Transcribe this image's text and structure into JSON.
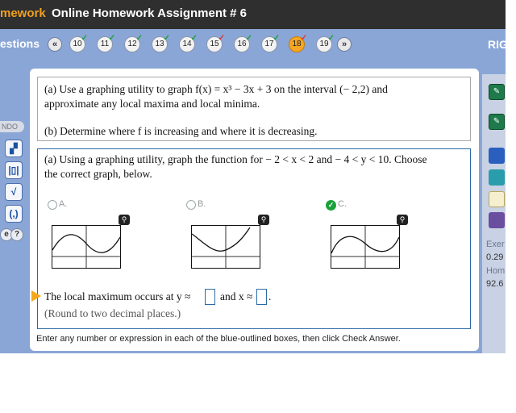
{
  "header": {
    "brand": "mework",
    "assignment_title": "Online Homework Assignment # 6"
  },
  "questions_bar": {
    "label": "estions",
    "prev_icon": "double-chevron-left-icon",
    "next_icon": "double-chevron-right-icon",
    "prev_glyph": "«",
    "next_glyph": "»",
    "items": [
      {
        "number": "10",
        "status": "complete"
      },
      {
        "number": "11",
        "status": "complete"
      },
      {
        "number": "12",
        "status": "complete"
      },
      {
        "number": "13",
        "status": "complete"
      },
      {
        "number": "14",
        "status": "complete"
      },
      {
        "number": "15",
        "status": "partial"
      },
      {
        "number": "16",
        "status": "complete"
      },
      {
        "number": "17",
        "status": "complete"
      },
      {
        "number": "18",
        "status": "current-partial"
      },
      {
        "number": "19",
        "status": "complete"
      }
    ],
    "right_label": "RIG"
  },
  "left_tools": {
    "pill_label": "NDO",
    "help_label": "?",
    "edge_label": "e"
  },
  "question": {
    "part_a_line1": "(a)  Use a graphing utility to graph f(x) = x³ − 3x + 3 on the interval (− 2,2) and",
    "part_a_line2": "approximate any local maxima and local minima.",
    "part_b": "(b)  Determine where f is increasing and where it is decreasing."
  },
  "answer": {
    "prompt_line1": "(a)  Using a graphing utility, graph the function for  − 2 < x < 2 and  − 4 < y < 10.  Choose",
    "prompt_line2": "the correct graph, below.",
    "options": [
      {
        "letter": "A.",
        "selected": false
      },
      {
        "letter": "B.",
        "selected": false
      },
      {
        "letter": "C.",
        "selected": true
      }
    ],
    "zoom_glyph": "⚲",
    "check_glyph": "✓",
    "local_max_prefix": "The local maximum occurs at y ≈",
    "local_max_mid": "and x ≈",
    "local_max_suffix": ".",
    "y_value": "",
    "x_value": "",
    "rounding_note": "(Round to two decimal places.)"
  },
  "footer": {
    "instruction": "Enter any number or expression in each of the blue-outlined boxes, then click Check Answer."
  },
  "right_panel": {
    "label_1": "Exer",
    "value_1": "0.29",
    "label_2": "Hom",
    "value_2": "92.6"
  },
  "colors": {
    "top_bar": "#2f2f2f",
    "brand": "#f0a020",
    "background_blue": "#8aa6d6",
    "current_question": "#f6a623",
    "check_green": "#1aa13a",
    "answer_border": "#2d6aa5"
  }
}
